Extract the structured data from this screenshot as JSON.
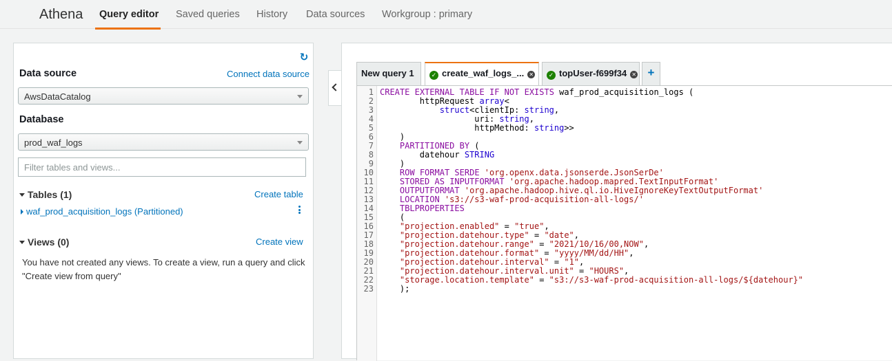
{
  "nav": {
    "brand": "Athena",
    "items": [
      "Query editor",
      "Saved queries",
      "History",
      "Data sources",
      "Workgroup : primary"
    ]
  },
  "left": {
    "data_source_label": "Data source",
    "connect_link": "Connect data source",
    "data_source_value": "AwsDataCatalog",
    "database_label": "Database",
    "database_value": "prod_waf_logs",
    "filter_placeholder": "Filter tables and views...",
    "tables_header": "Tables (1)",
    "create_table": "Create table",
    "table_item": "waf_prod_acquisition_logs (Partitioned)",
    "views_header": "Views (0)",
    "create_view": "Create view",
    "views_empty": "You have not created any views. To create a view, run a query and click \"Create view from query\""
  },
  "tabs": [
    "New query 1",
    "create_waf_logs_...",
    "topUser-f699f34"
  ],
  "add_tab": "+",
  "colors": {
    "accent": "#ec7211",
    "link": "#0073bb",
    "success": "#1d8102"
  },
  "icons": [
    "refresh-icon",
    "check-circle-icon",
    "close-circle-icon",
    "chevron-left-icon",
    "kebab-icon"
  ],
  "editor": {
    "lines": [
      "CREATE EXTERNAL TABLE IF NOT EXISTS waf_prod_acquisition_logs (",
      "        httpRequest array<",
      "            struct<clientIp: string,",
      "                   uri: string,",
      "                   httpMethod: string>>",
      "    )",
      "    PARTITIONED BY (",
      "        datehour STRING",
      "    )",
      "    ROW FORMAT SERDE 'org.openx.data.jsonserde.JsonSerDe'",
      "    STORED AS INPUTFORMAT 'org.apache.hadoop.mapred.TextInputFormat'",
      "    OUTPUTFORMAT 'org.apache.hadoop.hive.ql.io.HiveIgnoreKeyTextOutputFormat'",
      "    LOCATION 's3://s3-waf-prod-acquisition-all-logs/'",
      "    TBLPROPERTIES",
      "    (",
      "    \"projection.enabled\" = \"true\",",
      "    \"projection.datehour.type\" = \"date\",",
      "    \"projection.datehour.range\" = \"2021/10/16/00,NOW\",",
      "    \"projection.datehour.format\" = \"yyyy/MM/dd/HH\",",
      "    \"projection.datehour.interval\" = \"1\",",
      "    \"projection.datehour.interval.unit\" = \"HOURS\",",
      "    \"storage.location.template\" = \"s3://s3-waf-prod-acquisition-all-logs/${datehour}\"",
      "    );"
    ]
  }
}
